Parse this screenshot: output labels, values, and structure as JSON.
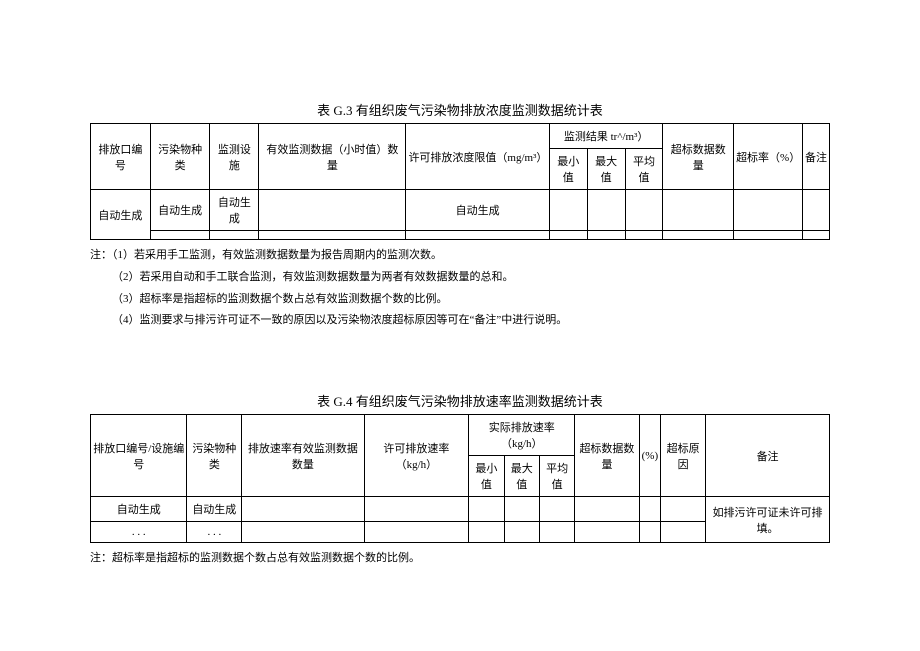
{
  "tableG3": {
    "title": "表 G.3 有组织废气污染物排放浓度监测数据统计表",
    "headers": {
      "col1": "排放口编号",
      "col2": "污染物种类",
      "col3": "监测设施",
      "col4": "有效监测数据（小时值）数量",
      "col5": "许可排放浓度限值（mg/m³）",
      "col6": "监测结果 tr^/m³）",
      "col6a": "最小值",
      "col6b": "最大值",
      "col6c": "平均值",
      "col7": "超标数据数量",
      "col8": "超标率（%）",
      "col9": "备注"
    },
    "rows": [
      {
        "c1": "自动生成",
        "c2": "自动生成",
        "c3": "自动生成",
        "c4": "",
        "c5": "自动生成",
        "c6a": "",
        "c6b": "",
        "c6c": "",
        "c7": "",
        "c8": "",
        "c9": ""
      },
      {
        "c2": "",
        "c3": "",
        "c4": "",
        "c5": "",
        "c6a": "",
        "c6b": "",
        "c6c": "",
        "c7": "",
        "c8": "",
        "c9": ""
      }
    ],
    "notes": {
      "n0": "注：（1）若采用手工监测，有效监测数据数量为报告周期内的监测次数。",
      "n1": "（2）若采用自动和手工联合监测，有效监测数据数量为两者有效数据数量的总和。",
      "n2": "（3）超标率是指超标的监测数据个数占总有效监测数据个数的比例。",
      "n3": "（4）监测要求与排污许可证不一致的原因以及污染物浓度超标原因等可在“备注”中进行说明。"
    }
  },
  "tableG4": {
    "title": "表 G.4 有组织废气污染物排放速率监测数据统计表",
    "headers": {
      "col1": "排放口编号/设施编号",
      "col2": "污染物种类",
      "col3": "排放速率有效监测数据数量",
      "col4": "许可排放速率（kg/h）",
      "col5": "实际排放速率（kg/h）",
      "col5a": "最小值",
      "col5b": "最大值",
      "col5c": "平均值",
      "col6": "超标数据数量",
      "col7": "(%)",
      "col8": "超标原因",
      "col9": "备注"
    },
    "rows": [
      {
        "c1": "自动生成",
        "c2": "自动生成",
        "c3": "",
        "c4": "",
        "c5a": "",
        "c5b": "",
        "c5c": "",
        "c6": "",
        "c7": "",
        "c8": "",
        "c9": "如排污许可证未许可排填。"
      },
      {
        "c1": ". . .",
        "c2": ". . .",
        "c3": "",
        "c4": "",
        "c5a": "",
        "c5b": "",
        "c5c": "",
        "c6": "",
        "c7": "",
        "c8": ""
      }
    ],
    "notes": {
      "n0": "注：超标率是指超标的监测数据个数占总有效监测数据个数的比例。"
    }
  }
}
